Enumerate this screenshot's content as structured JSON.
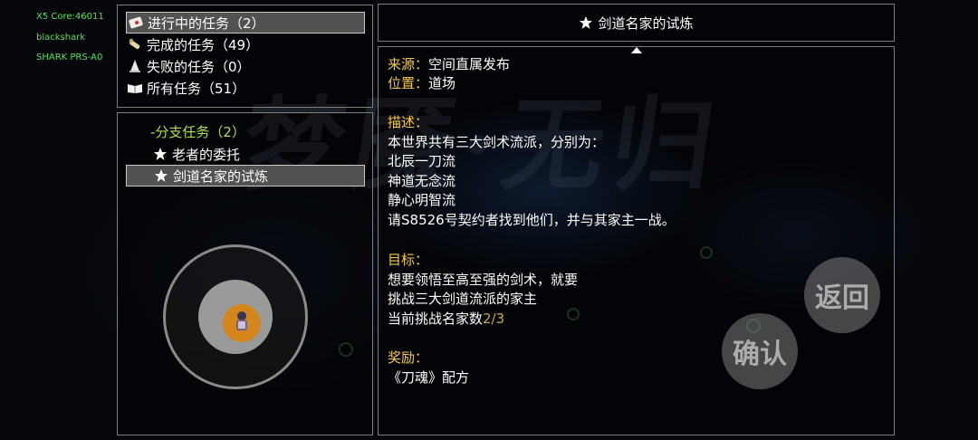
{
  "background_title": "梦魇·无归",
  "device_info": [
    "X5 Core:46011",
    "blackshark",
    "SHARK PRS-A0"
  ],
  "categories": [
    {
      "label": "进行中的任务（2）",
      "icon": "quest-scroll-icon",
      "selected": true
    },
    {
      "label": "完成的任务（49）",
      "icon": "rolled-scroll-icon",
      "selected": false
    },
    {
      "label": "失败的任务（0）",
      "icon": "cone-icon",
      "selected": false
    },
    {
      "label": "所有任务（51）",
      "icon": "book-icon",
      "selected": false
    }
  ],
  "quest_group": {
    "label": "-分支任务（2）"
  },
  "quests": [
    {
      "label": "老者的委托",
      "icon": "star-icon",
      "selected": false
    },
    {
      "label": "剑道名家的试炼",
      "icon": "star-icon",
      "selected": true
    }
  ],
  "detail": {
    "title": "剑道名家的试炼",
    "source_label": "来源：",
    "source_value": "空间直属发布",
    "location_label": "位置：",
    "location_value": "道场",
    "desc_label": "描述：",
    "desc_lines": [
      "本世界共有三大剑术流派，分别为：",
      "北辰一刀流",
      "神道无念流",
      "静心明智流",
      "请S8526号契约者找到他们，并与其家主一战。"
    ],
    "goal_label": "目标：",
    "goal_lines": [
      "想要领悟至高至强的剑术，就要",
      "挑战三大剑道流派的家主"
    ],
    "goal_progress_text": "当前挑战名家数",
    "goal_progress_value": "2/3",
    "reward_label": "奖励：",
    "reward_value": "《刀魂》配方"
  },
  "buttons": {
    "back": "返回",
    "confirm": "确认"
  },
  "colors": {
    "label": "#f5c743",
    "group": "#a9e04a",
    "progress": "#c7a93d",
    "selected_row": "#525252"
  }
}
